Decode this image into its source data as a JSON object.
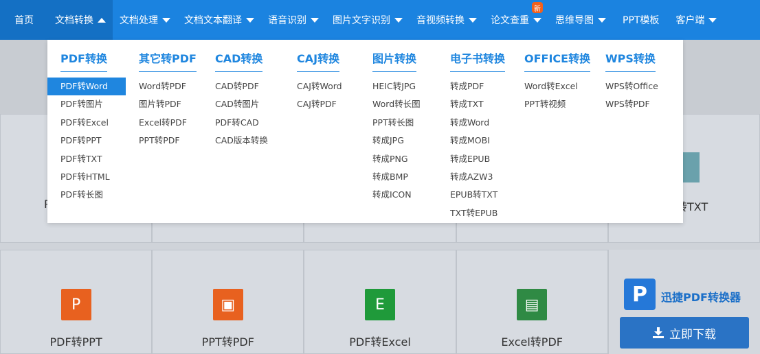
{
  "nav": {
    "home": "首页",
    "items": [
      {
        "label": "文档转换",
        "active": true
      },
      {
        "label": "文档处理"
      },
      {
        "label": "文档文本翻译"
      },
      {
        "label": "语音识别"
      },
      {
        "label": "图片文字识别"
      },
      {
        "label": "音视频转换"
      },
      {
        "label": "论文查重",
        "badge": "新"
      },
      {
        "label": "思维导图"
      },
      {
        "label": "PPT模板"
      },
      {
        "label": "客户端"
      }
    ]
  },
  "dropdown": {
    "columns": [
      {
        "title": "PDF转换",
        "items": [
          "PDF转Word",
          "PDF转图片",
          "PDF转Excel",
          "PDF转PPT",
          "PDF转TXT",
          "PDF转HTML",
          "PDF转长图"
        ],
        "selected_item": "PDF转Word"
      },
      {
        "title": "其它转PDF",
        "items": [
          "Word转PDF",
          "图片转PDF",
          "Excel转PDF",
          "PPT转PDF"
        ]
      },
      {
        "title": "CAD转换",
        "items": [
          "CAD转PDF",
          "CAD转图片",
          "PDF转CAD",
          "CAD版本转换"
        ]
      },
      {
        "title": "CAJ转换",
        "items": [
          "CAJ转Word",
          "CAJ转PDF"
        ]
      },
      {
        "title": "图片转换",
        "items": [
          "HEIC转JPG",
          "Word转长图",
          "PPT转长图",
          "转成JPG",
          "转成PNG",
          "转成BMP",
          "转成ICON"
        ]
      },
      {
        "title": "电子书转换",
        "items": [
          "转成PDF",
          "转成TXT",
          "转成Word",
          "转成MOBI",
          "转成EPUB",
          "转成AZW3",
          "EPUB转TXT",
          "TXT转EPUB"
        ]
      },
      {
        "title": "OFFICE转换",
        "items": [
          "Word转Excel",
          "PPT转视频"
        ]
      },
      {
        "title": "WPS转换",
        "items": [
          "WPS转Office",
          "WPS转PDF"
        ]
      }
    ]
  },
  "background": {
    "row1_left_label": "P",
    "row1_right_label": "转TXT",
    "row2": [
      {
        "label": "PDF转PPT",
        "icon": "ppt-icon",
        "color": "#e8611f",
        "glyph": "P"
      },
      {
        "label": "PPT转PDF",
        "icon": "ppt-pdf-icon",
        "color": "#e8611f",
        "glyph": "▣"
      },
      {
        "label": "PDF转Excel",
        "icon": "excel-icon",
        "color": "#1f9a3a",
        "glyph": "E"
      },
      {
        "label": "Excel转PDF",
        "icon": "excel-pdf-icon",
        "color": "#2f8a44",
        "glyph": "▤"
      }
    ]
  },
  "promo": {
    "logo_glyph": "P",
    "name": "迅捷PDF转换器",
    "button_label": "立即下载"
  },
  "colors": {
    "nav_bg": "#1b83e0",
    "accent": "#1f86df",
    "promo_button": "#2a73c5"
  }
}
